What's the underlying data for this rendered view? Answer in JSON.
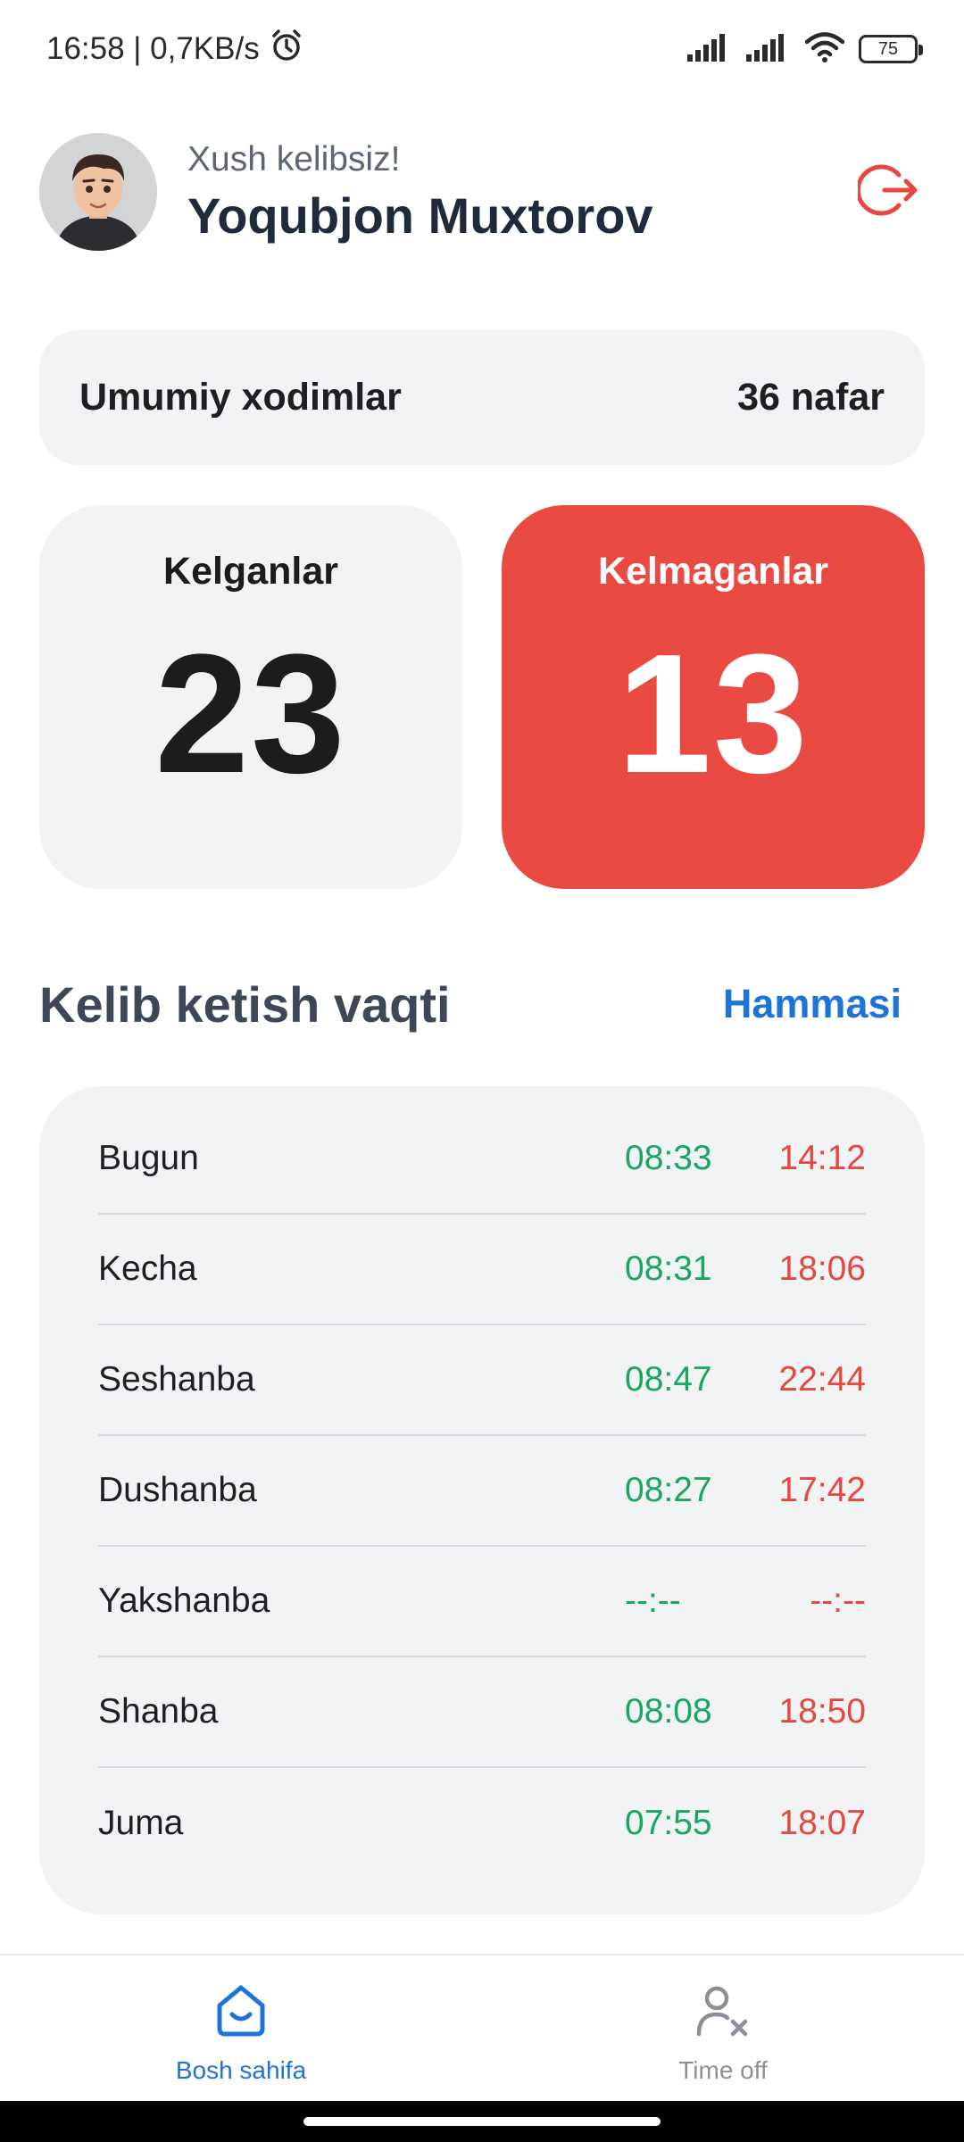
{
  "status_bar": {
    "time_speed": "16:58 | 0,7KB/s",
    "battery": "75",
    "icons": [
      "alarm-icon",
      "signal-icon",
      "signal-icon",
      "wifi-icon",
      "battery-icon"
    ]
  },
  "header": {
    "greeting": "Xush kelibsiz!",
    "user_name": "Yoqubjon Muxtorov",
    "icons": [
      "avatar",
      "logout-icon"
    ]
  },
  "summary": {
    "total_label": "Umumiy xodimlar",
    "total_value": "36 nafar",
    "came_label": "Kelganlar",
    "came_value": "23",
    "absent_label": "Kelmaganlar",
    "absent_value": "13"
  },
  "attendance": {
    "title": "Kelib ketish vaqti",
    "see_all": "Hammasi",
    "rows": [
      {
        "day": "Bugun",
        "in": "08:33",
        "out": "14:12"
      },
      {
        "day": "Kecha",
        "in": "08:31",
        "out": "18:06"
      },
      {
        "day": "Seshanba",
        "in": "08:47",
        "out": "22:44"
      },
      {
        "day": "Dushanba",
        "in": "08:27",
        "out": "17:42"
      },
      {
        "day": "Yakshanba",
        "in": "--:--",
        "out": "--:--"
      },
      {
        "day": "Shanba",
        "in": "08:08",
        "out": "18:50"
      },
      {
        "day": "Juma",
        "in": "07:55",
        "out": "18:07"
      }
    ]
  },
  "bottom_nav": {
    "home_label": "Bosh sahifa",
    "timeoff_label": "Time off",
    "icons": [
      "home-icon",
      "user-remove-icon"
    ]
  },
  "colors": {
    "accent_blue": "#1d74d6",
    "absent_red": "#e94b43",
    "in_green": "#19a661",
    "out_red": "#e4483f",
    "card_gray": "#f2f3f5"
  }
}
